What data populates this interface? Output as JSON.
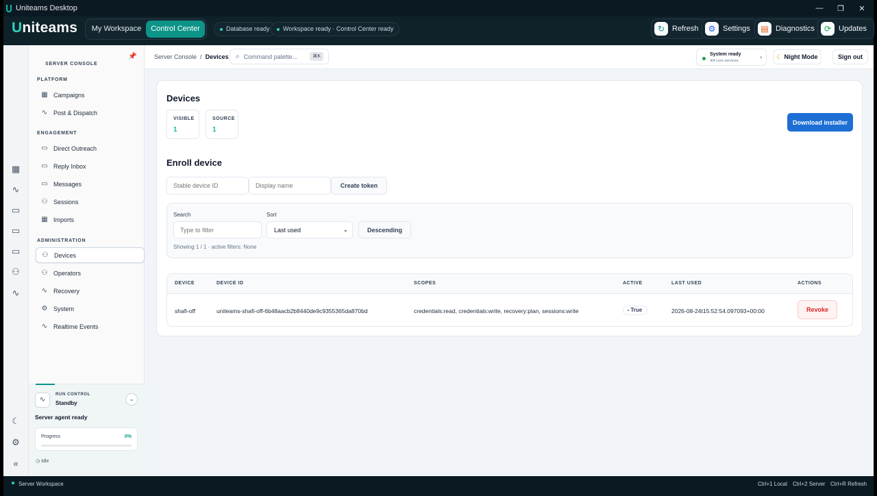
{
  "window": {
    "title": "Uniteams Desktop",
    "minimize": "—",
    "restore": "❐",
    "close": "✕"
  },
  "header": {
    "brand_first": "U",
    "brand_rest": "niteams",
    "workspace_tabs": [
      "My Workspace",
      "Control Center"
    ],
    "status_pills": [
      "Database ready",
      "Workspace ready · Control Center ready"
    ],
    "actions": [
      {
        "label": "Refresh",
        "icon": "refresh-icon",
        "glyph": "↻",
        "color": "#0d9488"
      },
      {
        "label": "Settings",
        "icon": "gear-icon",
        "glyph": "⚙",
        "color": "#2563eb"
      },
      {
        "label": "Diagnostics",
        "icon": "diagnostics-icon",
        "glyph": "▤",
        "color": "#ea580c"
      },
      {
        "label": "Updates",
        "icon": "updates-icon",
        "glyph": "⟳",
        "color": "#16a34a"
      }
    ]
  },
  "rail": {
    "icons": [
      "grid-icon",
      "activity-icon",
      "chat-icon",
      "chat-icon",
      "chat-icon",
      "users-icon",
      "activity-icon"
    ],
    "moon": "☾",
    "gear": "⚙",
    "collapse": "«"
  },
  "sidebar": {
    "title": "SERVER CONSOLE",
    "groups": [
      {
        "label": "PLATFORM",
        "items": [
          {
            "label": "Campaigns",
            "icon": "grid-icon"
          },
          {
            "label": "Post & Dispatch",
            "icon": "activity-icon"
          }
        ]
      },
      {
        "label": "ENGAGEMENT",
        "items": [
          {
            "label": "Direct Outreach",
            "icon": "chat-icon"
          },
          {
            "label": "Reply Inbox",
            "icon": "chat-icon"
          },
          {
            "label": "Messages",
            "icon": "chat-icon"
          },
          {
            "label": "Sessions",
            "icon": "users-icon"
          },
          {
            "label": "Imports",
            "icon": "grid-icon"
          }
        ]
      },
      {
        "label": "ADMINISTRATION",
        "items": [
          {
            "label": "Devices",
            "icon": "users-icon",
            "active": true
          },
          {
            "label": "Operators",
            "icon": "users-icon"
          },
          {
            "label": "Recovery",
            "icon": "activity-icon"
          },
          {
            "label": "System",
            "icon": "gear-icon"
          },
          {
            "label": "Realtime Events",
            "icon": "activity-icon"
          }
        ]
      }
    ],
    "run_control": {
      "label": "RUN CONTROL",
      "mode": "Standby",
      "agent_status": "Server agent ready",
      "progress_label": "Progress",
      "progress_value": "0%",
      "progress_fraction": 0,
      "state": "Idle"
    }
  },
  "topbar": {
    "breadcrumb_parent": "Server Console",
    "breadcrumb_sep": "/",
    "breadcrumb_current": "Devices",
    "command_placeholder": "Command palette...",
    "command_kbd": "⌘K",
    "system_status": "System ready",
    "system_sub": "4/4 core services",
    "night_mode": "Night Mode",
    "sign_out": "Sign out"
  },
  "devices": {
    "title": "Devices",
    "stats": [
      {
        "label": "VISIBLE",
        "value": "1"
      },
      {
        "label": "SOURCE",
        "value": "1"
      }
    ],
    "download_label": "Download installer",
    "enroll_title": "Enroll device",
    "device_id_placeholder": "Stable device ID",
    "display_name_placeholder": "Display name",
    "create_token_label": "Create token",
    "filters": {
      "search_label": "Search",
      "search_placeholder": "Type to filter",
      "sort_label": "Sort",
      "sort_value": "Last used",
      "order_label": "Descending",
      "summary": "Showing 1 / 1 · active filters: None"
    },
    "table": {
      "columns": [
        "DEVICE",
        "DEVICE ID",
        "SCOPES",
        "ACTIVE",
        "LAST USED",
        "ACTIONS"
      ],
      "rows": [
        {
          "device": "shafi-off",
          "device_id": "uniteams-shafi-off-6b48aacb2b8440de9c9355365da870bd",
          "scopes": "credentials:read, credentials:write, recovery:plan, sessions:write",
          "active": "True",
          "last_used": "2026-08-24t15:52:54.097093+00:00",
          "action": "Revoke"
        }
      ]
    }
  },
  "statusbar": {
    "workspace": "Server Workspace",
    "shortcuts": [
      "Ctrl+1  Local",
      "Ctrl+2  Server",
      "Ctrl+R  Refresh"
    ]
  }
}
